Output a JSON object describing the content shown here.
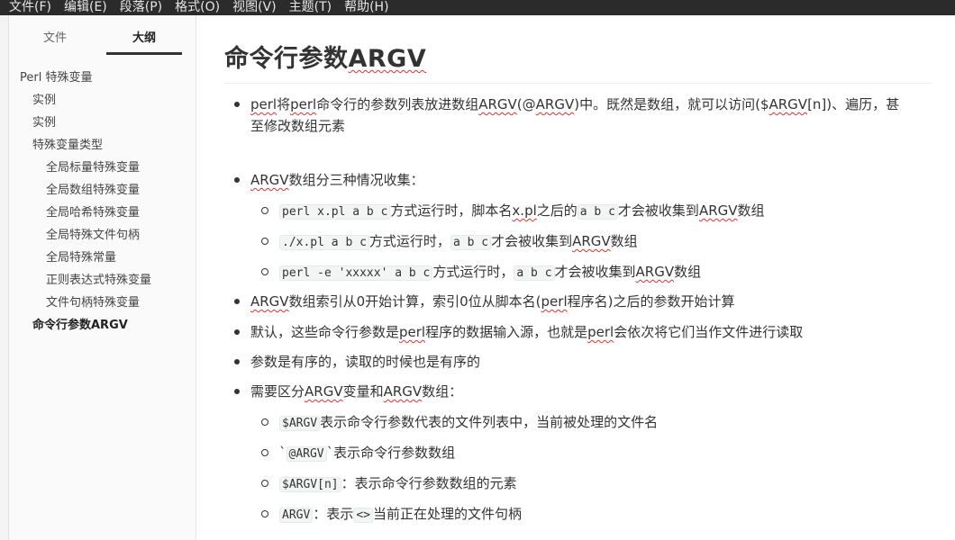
{
  "menu": [
    "文件(F)",
    "编辑(E)",
    "段落(P)",
    "格式(O)",
    "视图(V)",
    "主题(T)",
    "帮助(H)"
  ],
  "sidebar": {
    "tab_files": "文件",
    "tab_outline": "大纲",
    "outline": [
      {
        "label": "Perl 特殊变量",
        "level": 1
      },
      {
        "label": "实例",
        "level": 2
      },
      {
        "label": "实例",
        "level": 2
      },
      {
        "label": "特殊变量类型",
        "level": 2
      },
      {
        "label": "全局标量特殊变量",
        "level": 3
      },
      {
        "label": "全局数组特殊变量",
        "level": 3
      },
      {
        "label": "全局哈希特殊变量",
        "level": 3
      },
      {
        "label": "全局特殊文件句柄",
        "level": 3
      },
      {
        "label": "全局特殊常量",
        "level": 3
      },
      {
        "label": "正则表达式特殊变量",
        "level": 3
      },
      {
        "label": "文件句柄特殊变量",
        "level": 3
      },
      {
        "label": "命令行参数ARGV",
        "level": 2,
        "active": true
      }
    ]
  },
  "doc": {
    "title_cn": "命令行参数",
    "title_en": "ARGV",
    "b1": {
      "t1": "perl",
      "t2": "将",
      "t3": "perl",
      "t4": "命令行的参数列表放进数组",
      "t5": "ARGV",
      "t6": "(@",
      "t7": "ARGV",
      "t8": ")中。既然是数组，就可以访问($",
      "t9": "ARGV",
      "t10": "[n])、遍历，甚",
      "line2": "至修改数组元素"
    },
    "b2": {
      "t1": "ARGV",
      "t2": "数组分三种情况收集："
    },
    "s1": {
      "code1": "perl x.pl a b c",
      "t1": "方式运行时，脚本名",
      "t2": "x.pl",
      "t3": "之后的",
      "code2": "a b c",
      "t4": "才会被收集到",
      "t5": "ARGV",
      "t6": "数组"
    },
    "s2": {
      "code1": "./x.pl a b c",
      "t1": "方式运行时，",
      "code2": "a b c",
      "t2": "才会被收集到",
      "t3": "ARGV",
      "t4": "数组"
    },
    "s3": {
      "code1": "perl -e 'xxxxx' a b c",
      "t1": "方式运行时，",
      "code2": "a b c",
      "t2": "才会被收集到",
      "t3": "ARGV",
      "t4": "数组"
    },
    "b3": {
      "t1": "ARGV",
      "t2": "数组索引从0开始计算，索引0位从脚本名(",
      "t3": "perl",
      "t4": "程序名)之后的参数开始计算"
    },
    "b4": {
      "t1": "默认，这些命令行参数是",
      "t2": "perl",
      "t3": "程序的数据输入源，也就是",
      "t4": "perl",
      "t5": "会依次将它们当作文件进行读取"
    },
    "b5": {
      "t1": "参数是有序的，读取的时候也是有序的"
    },
    "b6": {
      "t1": "需要区分",
      "t2": "ARGV",
      "t3": "变量和",
      "t4": "ARGV",
      "t5": "数组："
    },
    "s4": {
      "code": "$ARGV",
      "t1": "表示命令行参数代表的文件列表中，当前被处理的文件名"
    },
    "s5": {
      "pre": "`",
      "code": "@ARGV",
      "post": "`",
      "t1": "表示命令行参数数组"
    },
    "s6": {
      "code": "$ARGV[n]",
      "t1": "：表示命令行参数数组的元素"
    },
    "s7": {
      "code1": "ARGV",
      "t1": "：表示",
      "code2": "<>",
      "t2": "当前正在处理的文件句柄"
    }
  }
}
